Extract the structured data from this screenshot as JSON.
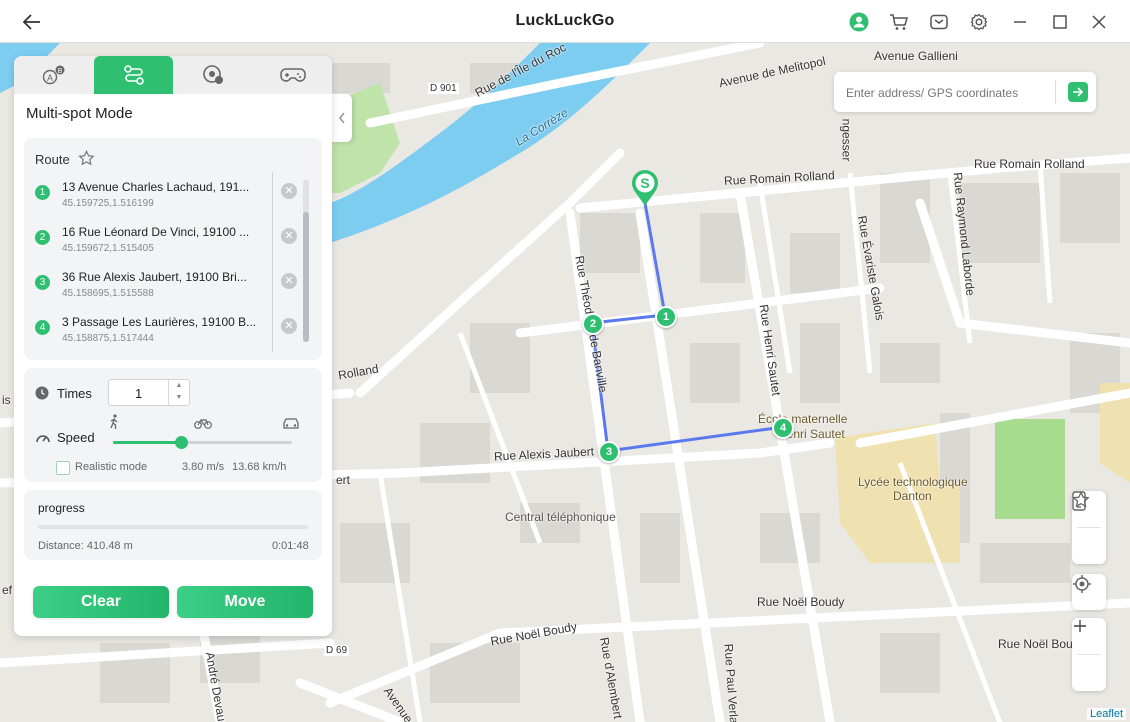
{
  "app": {
    "title": "LuckLuckGo"
  },
  "map": {
    "search_placeholder": "Enter address/ GPS coordinates",
    "attribution": "Leaflet",
    "labels": {
      "river": "La Corrèze",
      "rue_ile_du_roc": "Rue de l'Île du Roc",
      "d901": "D 901",
      "avenue_melitopol": "Avenue de Melitopol",
      "avenue_gallieni": "Avenue Gallieni",
      "rue_romain_rolland_1": "Rue Romain Rolland",
      "rue_romain_rolland_2": "Rue Romain Rolland",
      "ngesser": "ngesser",
      "rue_theodore_banville": "Rue Théodore de Banville",
      "rue_evariste_galois": "Rue Évariste Galois",
      "rue_raymond_laborde": "Rue Raymond Laborde",
      "rue_henri_sautet": "Rue Henri Sautet",
      "ecole_maternelle": "École maternelle",
      "henri_sautet": "Henri Sautet",
      "lycee": "Lycée technologique",
      "danton": "Danton",
      "rue_alexis_jaubert": "Rue Alexis Jaubert",
      "central_telephonique": "Central téléphonique",
      "rolland_left": "Rolland",
      "ert": "ert",
      "rue_noel_boudy_1": "Rue Noël Boudy",
      "rue_noel_boudy_2": "Rue Noël Boudy",
      "rue_noel_boudy_3": "Rue Noël Boudy",
      "d69": "D 69",
      "andre_devaud": "André Devaud",
      "avenue_bottom": "Avenue",
      "rue_alembert": "Rue d'Alembert",
      "rue_paul_verlaine": "Rue Paul Verlai",
      "left_is": "is",
      "left_ef": "ef"
    },
    "start_pin": "S",
    "route_pins": [
      "1",
      "2",
      "3",
      "4"
    ]
  },
  "panel": {
    "mode_title": "Multi-spot Mode",
    "route_label": "Route",
    "stops": [
      {
        "num": "1",
        "address": "13 Avenue Charles Lachaud, 191...",
        "coords": "45.159725,1.516199"
      },
      {
        "num": "2",
        "address": "16 Rue Léonard De Vinci, 19100 ...",
        "coords": "45.159672,1.515405"
      },
      {
        "num": "3",
        "address": "36 Rue Alexis Jaubert, 19100 Bri...",
        "coords": "45.158695,1.515588"
      },
      {
        "num": "4",
        "address": "3 Passage Les Laurières, 19100 B...",
        "coords": "45.158875,1.517444"
      }
    ],
    "times_label": "Times",
    "times_value": "1",
    "speed_label": "Speed",
    "speed_fraction": 0.38,
    "realistic_label": "Realistic mode",
    "speed_ms": "3.80 m/s",
    "speed_kmh": "13.68 km/h",
    "progress_label": "progress",
    "progress_fraction": 0,
    "distance": "Distance: 410.48 m",
    "elapsed": "0:01:48",
    "clear_label": "Clear",
    "move_label": "Move"
  },
  "colors": {
    "accent": "#2fbf71",
    "route": "#5b79ef",
    "water": "#7dcdf0",
    "park": "#a7dc8e",
    "school": "#efe1b0"
  }
}
